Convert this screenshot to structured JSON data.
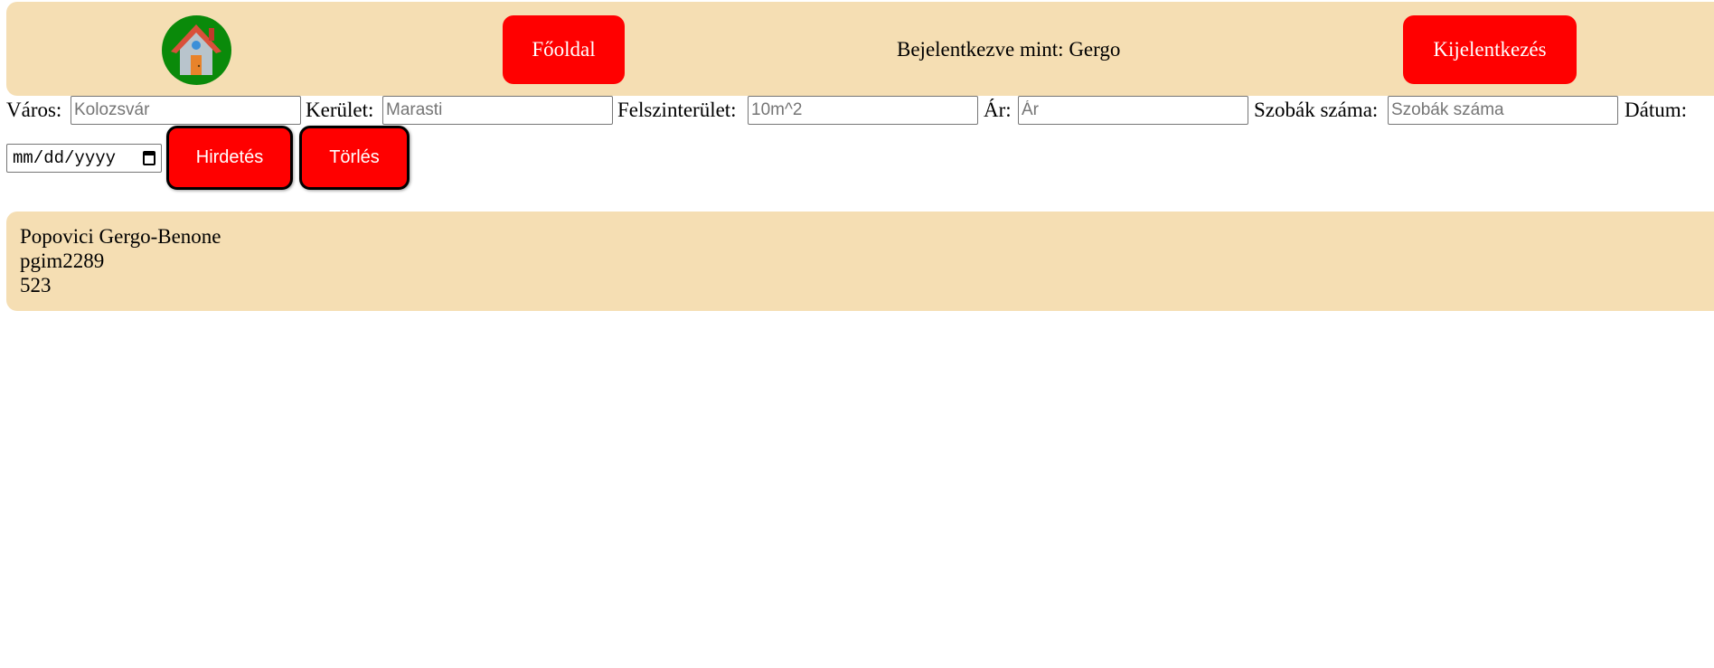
{
  "header": {
    "logo_icon": "house-icon",
    "home_label": "Főoldal",
    "logged_in_text": "Bejelentkezve mint: Gergo",
    "logout_label": "Kijelentkezés"
  },
  "form": {
    "city": {
      "label": "Város:",
      "placeholder": "Kolozsvár"
    },
    "district": {
      "label": "Kerület:",
      "placeholder": "Marasti"
    },
    "area": {
      "label": "Felszinterület:",
      "placeholder": "10m^2"
    },
    "price": {
      "label": "Ár:",
      "placeholder": "Ár"
    },
    "rooms": {
      "label": "Szobák száma:",
      "placeholder": "Szobák száma"
    },
    "date": {
      "label": "Dátum:",
      "placeholder": "mm/dd/yyyy",
      "icon": "calendar-icon"
    },
    "post_label": "Hirdetés",
    "delete_label": "Törlés"
  },
  "user_card": {
    "name": "Popovici Gergo-Benone",
    "username": "pgim2289",
    "group": "523"
  },
  "colors": {
    "panel_bg": "#f5deb3",
    "button_bg": "#ff0000",
    "logo_bg": "#0a8a0a"
  }
}
